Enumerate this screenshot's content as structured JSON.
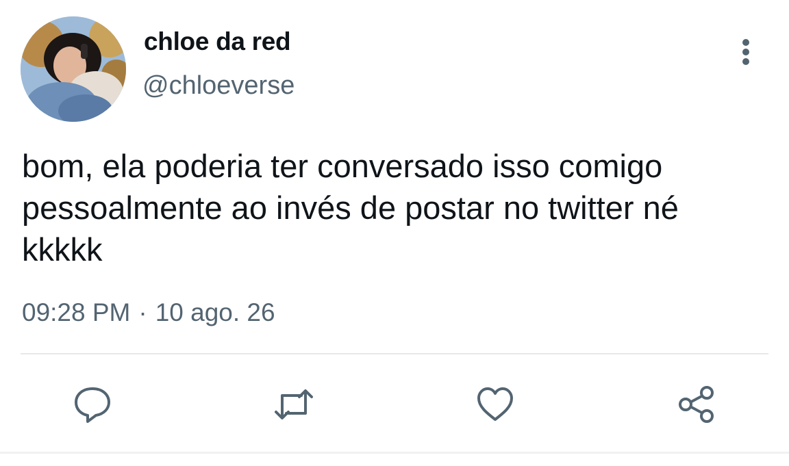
{
  "user": {
    "display_name": "chloe da red",
    "handle": "@chloeverse"
  },
  "tweet": {
    "text": "bom, ela poderia ter conversado isso comigo\npessoalmente ao invés de postar no twitter né\nkkkkk",
    "time": "09:28 PM",
    "separator": "·",
    "date": "10 ago. 26"
  },
  "icons": {
    "more": "more-vertical-icon",
    "reply": "comment-icon",
    "retweet": "retweet-icon",
    "like": "heart-icon",
    "share": "share-icon"
  },
  "colors": {
    "text": "#0f1419",
    "secondary": "#536471",
    "icon": "#536471",
    "divider": "#e6e9eb"
  }
}
